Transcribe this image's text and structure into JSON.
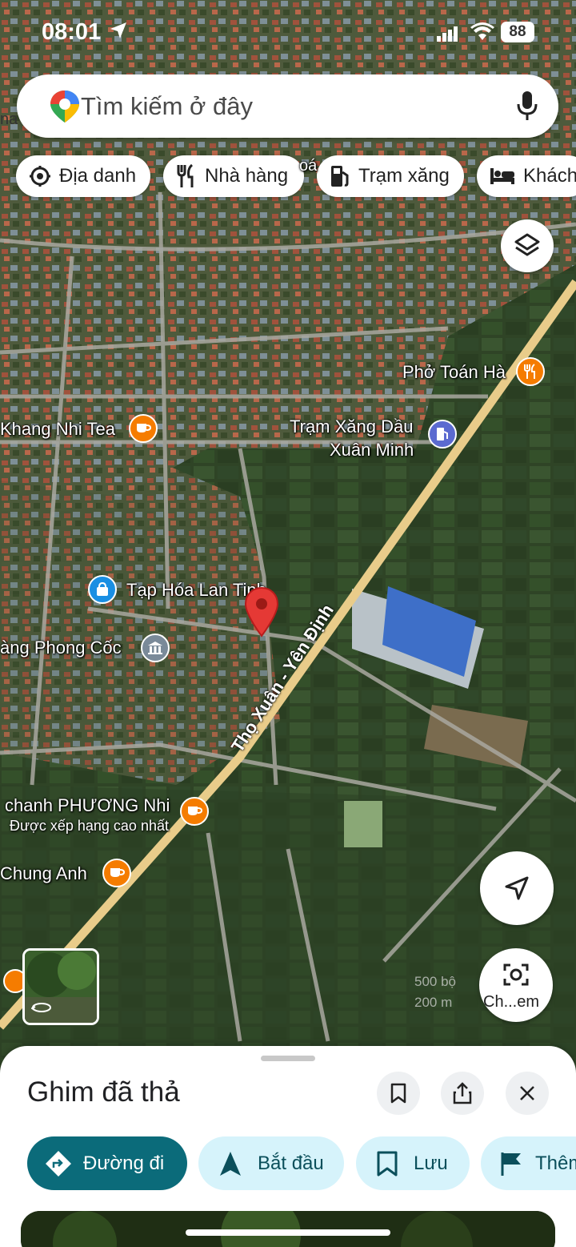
{
  "status_bar": {
    "time": "08:01",
    "battery": "88"
  },
  "search": {
    "placeholder": "Tìm kiếm ở đây"
  },
  "chips": [
    {
      "label": "Địa danh",
      "icon": "landmark-icon"
    },
    {
      "label": "Nhà hàng",
      "icon": "restaurant-icon"
    },
    {
      "label": "Trạm xăng",
      "icon": "gas-station-icon"
    },
    {
      "label": "Khách",
      "icon": "hotel-icon"
    }
  ],
  "map": {
    "edge_labels": [
      "na",
      "oá"
    ],
    "pois": [
      {
        "name": "Phở Toán Hà",
        "icon": "restaurant-icon",
        "color": "#f57c00"
      },
      {
        "name": "Khang Nhi Tea",
        "icon": "cafe-icon",
        "color": "#f57c00"
      },
      {
        "name": "Trạm Xăng Dầu",
        "name2": "Xuân Minh",
        "icon": "gas-station-icon",
        "color": "#5b6ad0"
      },
      {
        "name": "Tạp Hóa Lan Tinh",
        "icon": "shopping-icon",
        "color": "#1a8fe3"
      },
      {
        "name": "àng Phong Cốc",
        "icon": "museum-icon",
        "color": "#7a8a99"
      },
      {
        "name": "chanh PHƯƠNG Nhi",
        "subtitle": "Được xếp hạng cao nhất",
        "icon": "cafe-icon",
        "color": "#f57c00"
      },
      {
        "name": "Chung Anh",
        "icon": "cafe-icon",
        "color": "#f57c00"
      }
    ],
    "road": "Thọ Xuân - Yên Định",
    "scale_ft": "500 bộ",
    "scale_m": "200 m",
    "lens_label": "Ch...em"
  },
  "sheet": {
    "title": "Ghim đã thả",
    "actions": [
      {
        "label": "Đường đi",
        "icon": "directions-icon"
      },
      {
        "label": "Bắt đầu",
        "icon": "navigation-arrow-icon"
      },
      {
        "label": "Lưu",
        "icon": "bookmark-icon"
      },
      {
        "label": "Thêm",
        "icon": "flag-icon"
      }
    ]
  },
  "colors": {
    "accent": "#0b6b7a",
    "chip_bg": "#d6f3fb",
    "pin": "#e53935"
  }
}
